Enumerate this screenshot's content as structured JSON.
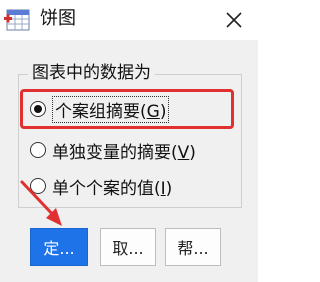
{
  "window": {
    "title": "饼图",
    "app_icon": "chart-app-icon",
    "close_icon": "close-icon"
  },
  "group": {
    "legend": "图表中的数据为",
    "options": [
      {
        "label": "个案组摘要(",
        "mnemonic": "G",
        "suffix": ")",
        "checked": true
      },
      {
        "label": "单独变量的摘要(",
        "mnemonic": "V",
        "suffix": ")",
        "checked": false
      },
      {
        "label": "单个个案的值(",
        "mnemonic": "I",
        "suffix": ")",
        "checked": false
      }
    ]
  },
  "buttons": {
    "ok": "定...",
    "cancel": "取...",
    "help": "帮..."
  },
  "colors": {
    "highlight": "#e03030",
    "primary": "#1e73e8",
    "annotation_arrow": "#e03030"
  }
}
